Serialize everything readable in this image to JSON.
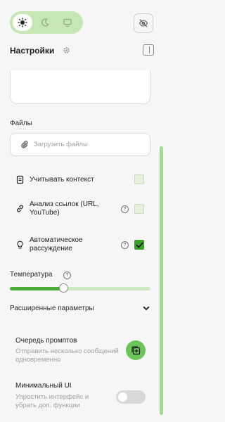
{
  "header": {
    "title": "Настройки"
  },
  "files": {
    "label": "Файлы",
    "upload_label": "Загрузить файлы"
  },
  "options": {
    "context_label": "Учитывать контекст",
    "links_label": "Анализ ссылок (URL, YouTube)",
    "reasoning_label": "Автоматическое рассуждение",
    "help_symbol": "?"
  },
  "temperature": {
    "label": "Температура",
    "help_symbol": "?",
    "value_fraction": 0.37
  },
  "advanced": {
    "label": "Расширенные параметры"
  },
  "queue": {
    "title": "Очередь промптов",
    "description": "Отправить несколько сообщений одновременно"
  },
  "minimal_ui": {
    "title": "Минимальный UI",
    "description": "Упростить интерфейс и убрать доп. функции"
  },
  "colors": {
    "accent": "#3d9c2e",
    "toggle_bg": "#c6e6b5",
    "scroll_thumb": "#a7d796"
  },
  "icons": [
    "sun-icon",
    "moon-icon",
    "monitor-icon",
    "eye-off-icon",
    "gear-icon",
    "panel-icon",
    "paperclip-icon",
    "context-icon",
    "link-icon",
    "bulb-icon",
    "help-icon",
    "chevron-down-icon",
    "queue-add-icon"
  ]
}
